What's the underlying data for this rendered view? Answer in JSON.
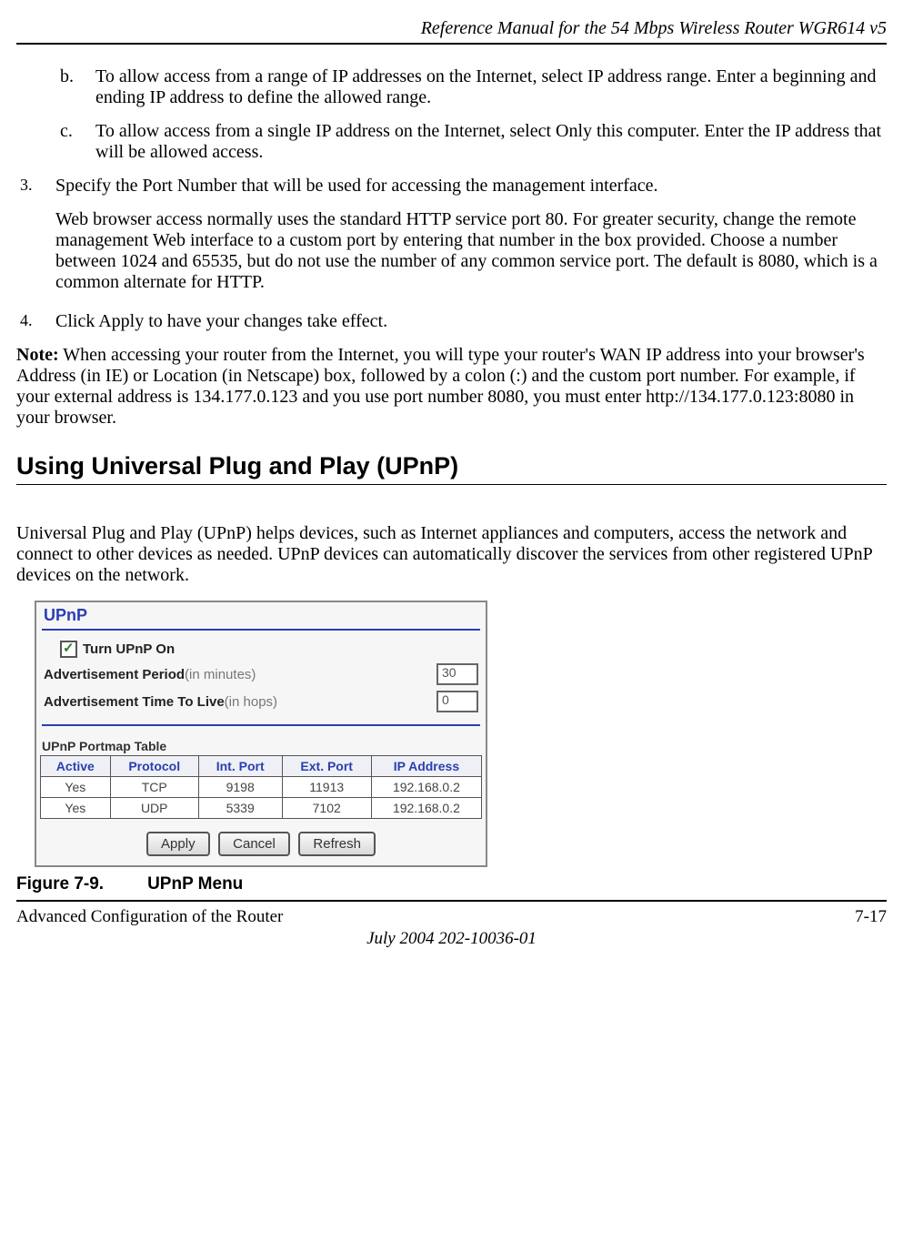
{
  "header": {
    "title": "Reference Manual for the 54 Mbps Wireless Router WGR614 v5"
  },
  "content": {
    "item_b": {
      "marker": "b.",
      "text": "To allow access from a range of IP addresses on the Internet, select IP address range. Enter a beginning and ending IP address to define the allowed range."
    },
    "item_c": {
      "marker": "c.",
      "text": "To allow access from a single IP address on the Internet, select Only this computer. Enter the IP address that will be allowed access."
    },
    "item_3": {
      "marker": "3.",
      "text1": "Specify the Port Number that will be used for accessing the management interface.",
      "text2": "Web browser access normally uses the standard HTTP service port 80. For greater security, change the remote management Web interface to a custom port by entering that number in the box provided. Choose a number between 1024 and 65535, but do not use the number of any common service port. The default is 8080, which is a common alternate for HTTP."
    },
    "item_4": {
      "marker": "4.",
      "text": "Click Apply to have your changes take effect."
    },
    "note_label": "Note:",
    "note_text": " When accessing your router from the Internet, you will type your router's WAN IP address into your browser's Address (in IE) or Location (in Netscape) box, followed by a colon (:) and the custom port number. For example, if your external address is 134.177.0.123 and you use port number 8080, you must enter http://134.177.0.123:8080 in your browser.",
    "section_heading": "Using Universal Plug and Play (UPnP)",
    "upnp_intro": "Universal Plug and Play (UPnP) helps devices, such as Internet appliances and computers, access the network and connect to other devices as needed. UPnP devices can automatically discover the services from other registered UPnP devices on the network."
  },
  "upnp_ui": {
    "title": "UPnP",
    "turn_on_label": "Turn UPnP On",
    "adv_period_label_bold": "Advertisement Period",
    "adv_period_label_grey": " (in minutes)",
    "adv_period_value": "30",
    "adv_ttl_label_bold": "Advertisement Time To Live",
    "adv_ttl_label_grey": " (in hops)",
    "adv_ttl_value": "0",
    "portmap_title": "UPnP Portmap Table",
    "headers": {
      "active": "Active",
      "protocol": "Protocol",
      "intport": "Int. Port",
      "extport": "Ext. Port",
      "ip": "IP Address"
    },
    "rows": [
      {
        "active": "Yes",
        "protocol": "TCP",
        "intport": "9198",
        "extport": "11913",
        "ip": "192.168.0.2"
      },
      {
        "active": "Yes",
        "protocol": "UDP",
        "intport": "5339",
        "extport": "7102",
        "ip": "192.168.0.2"
      }
    ],
    "buttons": {
      "apply": "Apply",
      "cancel": "Cancel",
      "refresh": "Refresh"
    }
  },
  "figure": {
    "num": "Figure 7-9.",
    "caption": "UPnP Menu"
  },
  "footer": {
    "left": "Advanced Configuration of the Router",
    "right": "7-17",
    "date": "July 2004 202-10036-01"
  }
}
